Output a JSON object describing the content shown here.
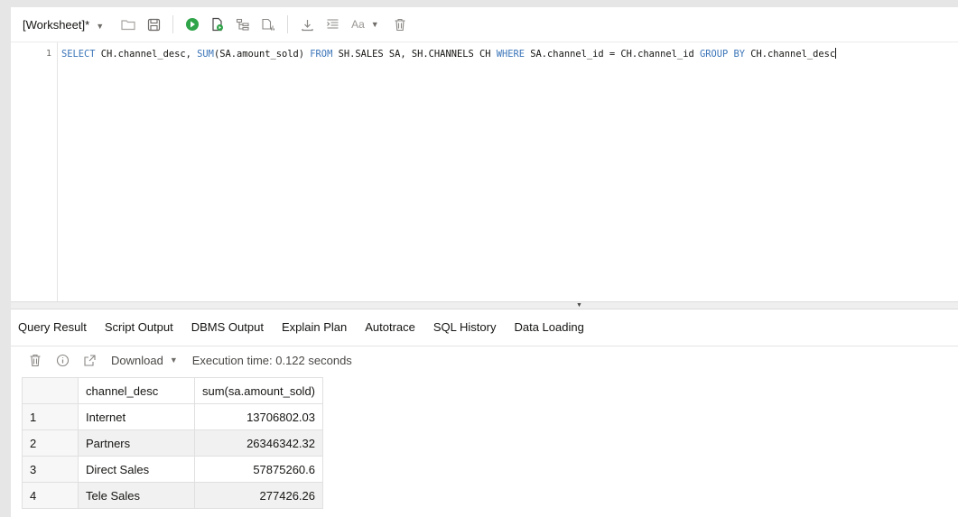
{
  "worksheet": {
    "title": "[Worksheet]*"
  },
  "toolbar": {
    "icons": [
      "folder-open-icon",
      "save-icon",
      "run-statement-icon",
      "run-script-icon",
      "explain-plan-icon",
      "autotrace-icon",
      "download-icon",
      "format-icon",
      "font-size-icon",
      "clear-icon"
    ],
    "font_label": "Aa",
    "run_color": "#2fa449"
  },
  "editor": {
    "line_number": "1",
    "tokens": [
      {
        "t": "SELECT",
        "kw": true
      },
      {
        "t": " CH.channel_desc, ",
        "kw": false
      },
      {
        "t": "SUM",
        "kw": true
      },
      {
        "t": "(SA.amount_sold) ",
        "kw": false
      },
      {
        "t": "FROM",
        "kw": true
      },
      {
        "t": " SH.SALES SA, SH.CHANNELS CH ",
        "kw": false
      },
      {
        "t": "WHERE",
        "kw": true
      },
      {
        "t": " SA.channel_id = CH.channel_id ",
        "kw": false
      },
      {
        "t": "GROUP BY",
        "kw": true
      },
      {
        "t": " CH.channel_desc",
        "kw": false
      }
    ]
  },
  "tabs": [
    {
      "label": "Query Result",
      "active": true
    },
    {
      "label": "Script Output",
      "active": false
    },
    {
      "label": "DBMS Output",
      "active": false
    },
    {
      "label": "Explain Plan",
      "active": false
    },
    {
      "label": "Autotrace",
      "active": false
    },
    {
      "label": "SQL History",
      "active": false
    },
    {
      "label": "Data Loading",
      "active": false
    }
  ],
  "results": {
    "download_label": "Download",
    "execution_time": "Execution time: 0.122 seconds",
    "columns": [
      "channel_desc",
      "sum(sa.amount_sold)"
    ],
    "rows": [
      {
        "n": "1",
        "desc": "Internet",
        "sum": "13706802.03"
      },
      {
        "n": "2",
        "desc": "Partners",
        "sum": "26346342.32"
      },
      {
        "n": "3",
        "desc": "Direct Sales",
        "sum": "57875260.6"
      },
      {
        "n": "4",
        "desc": "Tele Sales",
        "sum": "277426.26"
      }
    ]
  }
}
